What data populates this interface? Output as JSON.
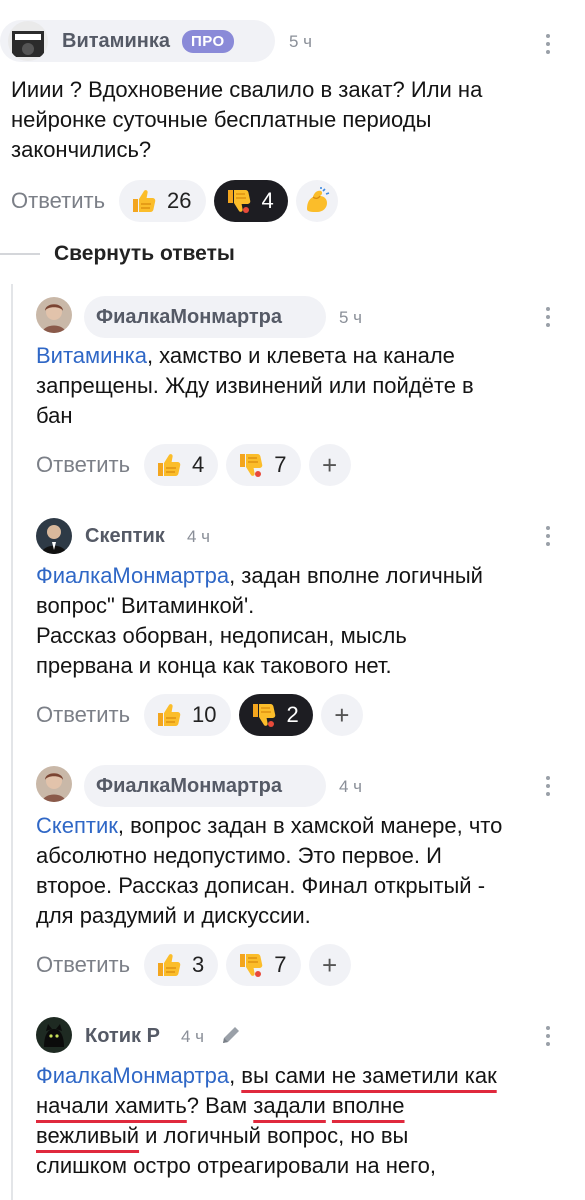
{
  "comments": [
    {
      "author": "Витаминка",
      "badge": "ПРО",
      "time": "5 ч",
      "text": "Ииии ? Вдохновение свалило в закат? Или на\nнейронке суточные бесплатные периоды\nзакончились?",
      "reply_label": "Ответить",
      "likes": "26",
      "dislikes": "4"
    },
    {
      "author": "ФиалкаМонмартра",
      "time": "5 ч",
      "mention": "Витаминка",
      "text": ", хамство и клевета на канале\nзапрещены. Жду извинений или пойдёте в\nбан",
      "reply_label": "Ответить",
      "likes": "4",
      "dislikes": "7"
    },
    {
      "author": "Скептик",
      "time": "4 ч",
      "mention": "ФиалкаМонмартра",
      "text": ", задан вполне логичный\nвопрос\" Витаминкой'.\nРассказ оборван, недописан, мысль\nпрервана и конца как такового нет.",
      "reply_label": "Ответить",
      "likes": "10",
      "dislikes": "2"
    },
    {
      "author": "ФиалкаМонмартра",
      "time": "4 ч",
      "mention": "Скептик",
      "text": ", вопрос задан в хамской манере, что\nабсолютно недопустимо. Это первое. И\nвторое. Рассказ дописан. Финал открытый -\nдля раздумий и дискуссии.",
      "reply_label": "Ответить",
      "likes": "3",
      "dislikes": "7"
    },
    {
      "author": "Котик Р",
      "time": "4 ч",
      "mention": "ФиалкаМонмартра",
      "text_parts": [
        ", ",
        "вы сами не заметили как",
        "\n",
        "начали хамить",
        "? Вам ",
        "задали",
        " ",
        "вполне",
        "\n",
        "вежливый",
        " и логичный вопрос, но вы\nслишком остро отреагировали на него,"
      ]
    }
  ],
  "collapse_label": "Свернуть ответы",
  "icons": {
    "like": "thumbs-up-emoji",
    "dislike": "thumbs-down-emoji",
    "add_reaction": "flexed-biceps-emoji",
    "add": "plus-icon",
    "menu": "kebab-menu-icon",
    "edit": "pencil-icon"
  },
  "colors": {
    "mention": "#2f67c6",
    "pro_badge": "#8a8ad8",
    "underline": "#e0293d"
  }
}
